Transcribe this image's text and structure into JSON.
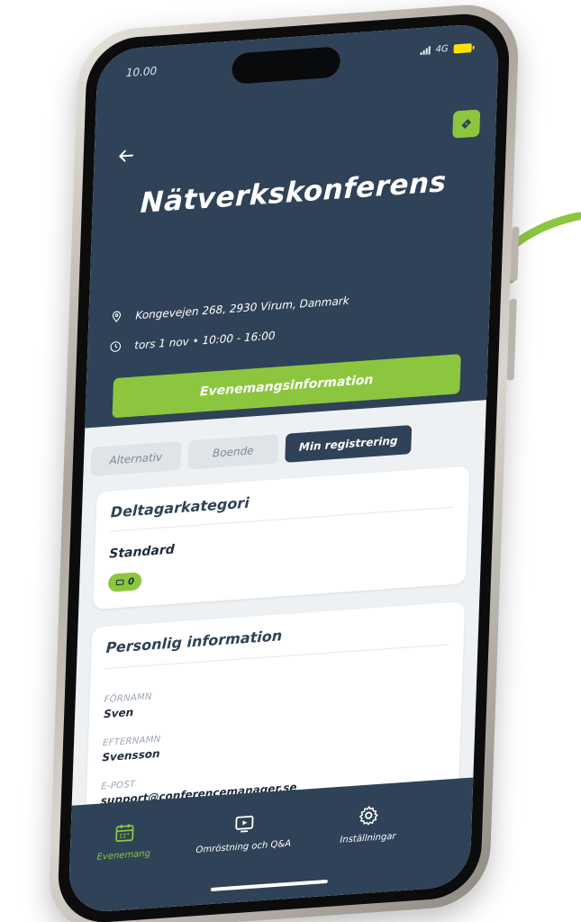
{
  "status_bar": {
    "time": "10.00",
    "network": "4G"
  },
  "header": {
    "title": "Nätverkskonferens",
    "back_icon": "arrow-left-icon",
    "action_icon": "ticket-icon"
  },
  "event": {
    "address": "Kongevejen 268, 2930 Virum, Danmark",
    "datetime": "tors 1 nov • 10:00 - 16:00"
  },
  "primary_button": {
    "label": "Evenemangsinformation"
  },
  "tabs": [
    {
      "label": "Alternativ",
      "active": false
    },
    {
      "label": "Boende",
      "active": false
    },
    {
      "label": "Min registrering",
      "active": true
    }
  ],
  "category_card": {
    "title": "Deltagarkategori",
    "value": "Standard",
    "badge_count": "0"
  },
  "personal_card": {
    "title": "Personlig information",
    "fields": [
      {
        "label": "FÖRNAMN",
        "value": "Sven"
      },
      {
        "label": "EFTERNAMN",
        "value": "Svensson"
      },
      {
        "label": "E-POST",
        "value": "support@conferencemanager.se"
      }
    ]
  },
  "bottom_nav": [
    {
      "label": "Evenemang",
      "icon": "calendar-icon",
      "active": true
    },
    {
      "label": "Omröstning och Q&A",
      "icon": "video-icon",
      "active": false
    },
    {
      "label": "Inställningar",
      "icon": "gear-icon",
      "active": false
    }
  ],
  "colors": {
    "navy": "#2f4257",
    "green": "#8cc63f",
    "background": "#eef1f4"
  }
}
